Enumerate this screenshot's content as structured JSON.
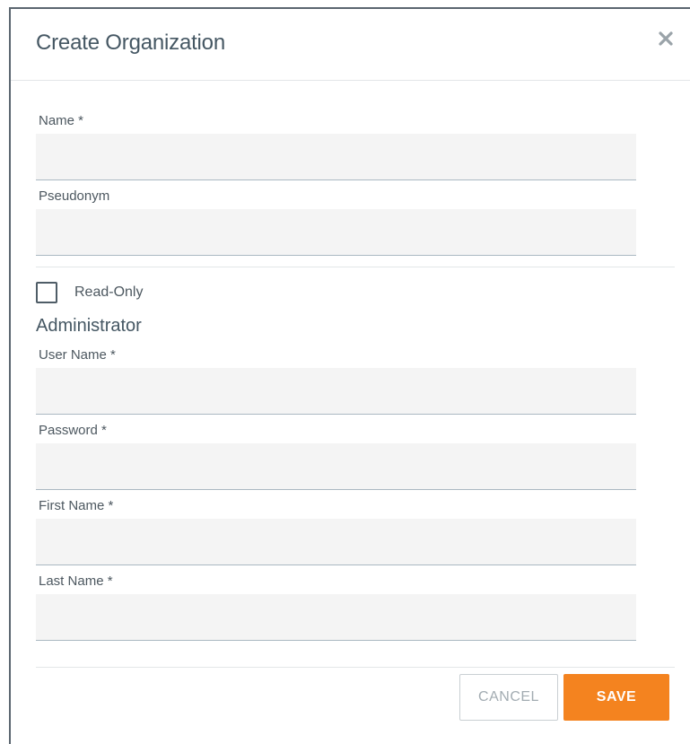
{
  "dialog": {
    "title": "Create Organization",
    "close_icon": "close-icon"
  },
  "fields": {
    "name": {
      "label": "Name *",
      "value": "",
      "placeholder": ""
    },
    "pseudonym": {
      "label": "Pseudonym",
      "value": "",
      "placeholder": ""
    }
  },
  "read_only": {
    "label": "Read-Only",
    "checked": false
  },
  "administrator": {
    "title": "Administrator",
    "user_name": {
      "label": "User Name *",
      "value": "",
      "placeholder": ""
    },
    "password": {
      "label": "Password *",
      "value": "",
      "placeholder": ""
    },
    "first_name": {
      "label": "First Name *",
      "value": "",
      "placeholder": ""
    },
    "last_name": {
      "label": "Last Name *",
      "value": "",
      "placeholder": ""
    }
  },
  "actions": {
    "cancel_label": "CANCEL",
    "save_label": "SAVE"
  },
  "colors": {
    "accent": "#f4831f",
    "title": "#455763",
    "input_bg": "#f4f4f4"
  }
}
